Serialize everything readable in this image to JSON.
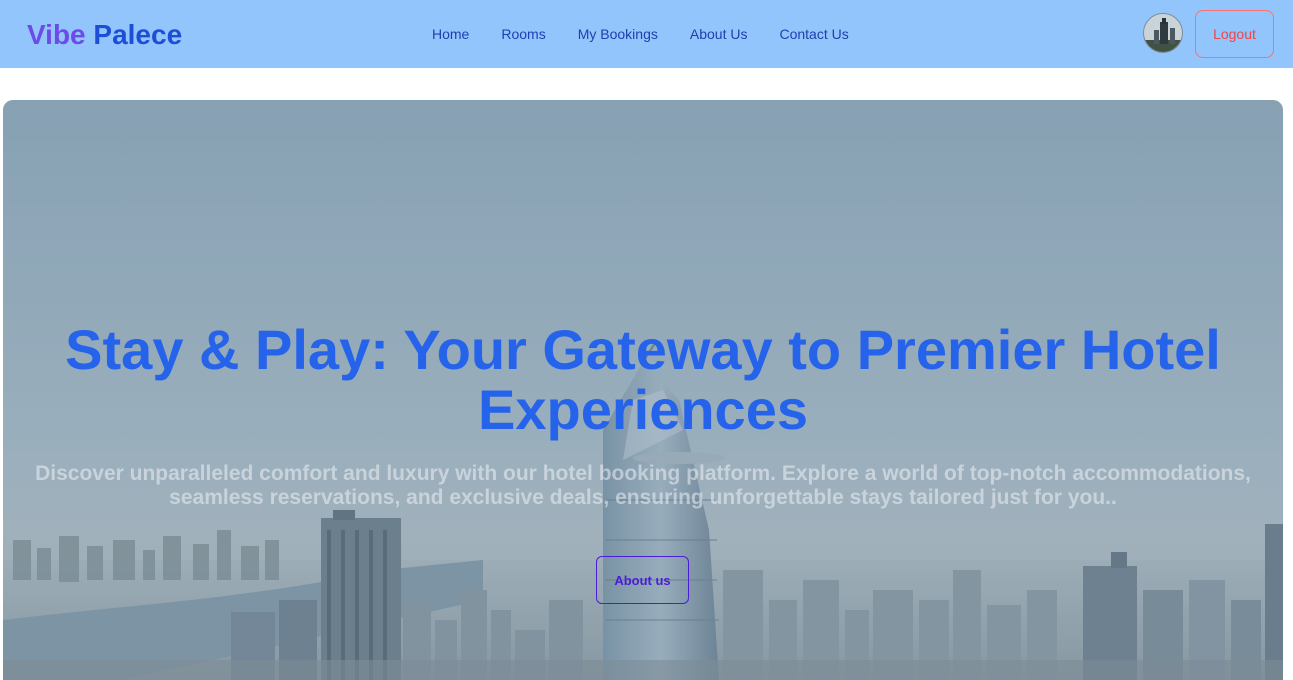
{
  "brand": {
    "part1": "Vibe",
    "part2": "Palece"
  },
  "nav": {
    "links": [
      "Home",
      "Rooms",
      "My Bookings",
      "About Us",
      "Contact Us"
    ]
  },
  "user": {
    "logout_label": "Logout",
    "avatar_icon": "user-avatar-photo"
  },
  "hero": {
    "title": "Stay & Play: Your Gateway to Premier Hotel Experiences",
    "subtitle": "Discover unparalleled comfort and luxury with our hotel booking platform. Explore a world of top-notch accommodations, seamless reservations, and exclusive deals, ensuring unforgettable stays tailored just for you..",
    "button_label": "About us"
  },
  "colors": {
    "navbar_bg": "#93c5fd",
    "brand_accent": "#6d4be8",
    "brand_primary": "#1d4ed8",
    "logout": "#ef4444",
    "hero_title": "#2563eb",
    "hero_button": "#4c1dd8"
  }
}
